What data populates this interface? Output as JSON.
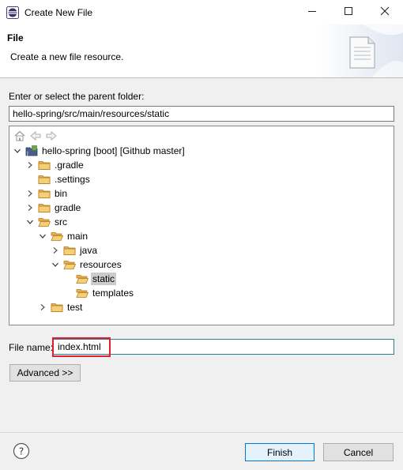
{
  "window": {
    "title": "Create New File",
    "icons": {
      "app": "eclipse-icon",
      "minimize": "minimize-icon",
      "maximize": "maximize-icon",
      "close": "close-icon"
    }
  },
  "header": {
    "title": "File",
    "description": "Create a new file resource.",
    "graphic": "new-file-wizard-icon"
  },
  "parent_folder": {
    "label": "Enter or select the parent folder:",
    "value": "hello-spring/src/main/resources/static"
  },
  "tree_toolbar": {
    "icons": [
      "home-icon",
      "back-arrow-icon",
      "forward-arrow-icon"
    ]
  },
  "tree": {
    "items": [
      {
        "label": "hello-spring [boot] [Github master]",
        "level": 0,
        "expanded": true,
        "type": "project"
      },
      {
        "label": ".gradle",
        "level": 1,
        "expanded": false,
        "type": "folder"
      },
      {
        "label": ".settings",
        "level": 1,
        "leaf": true,
        "type": "folder"
      },
      {
        "label": "bin",
        "level": 1,
        "expanded": false,
        "type": "folder"
      },
      {
        "label": "gradle",
        "level": 1,
        "expanded": false,
        "type": "folder"
      },
      {
        "label": "src",
        "level": 1,
        "expanded": true,
        "type": "folder"
      },
      {
        "label": "main",
        "level": 2,
        "expanded": true,
        "type": "folder"
      },
      {
        "label": "java",
        "level": 3,
        "expanded": false,
        "type": "folder"
      },
      {
        "label": "resources",
        "level": 3,
        "expanded": true,
        "type": "folder"
      },
      {
        "label": "static",
        "level": 4,
        "leaf": true,
        "type": "folder",
        "selected": true
      },
      {
        "label": "templates",
        "level": 4,
        "leaf": true,
        "type": "folder"
      },
      {
        "label": "test",
        "level": 2,
        "expanded": false,
        "type": "folder"
      }
    ]
  },
  "file_name": {
    "label": "File name:",
    "value": "index.html"
  },
  "buttons": {
    "advanced": "Advanced >>",
    "finish": "Finish",
    "cancel": "Cancel",
    "help_icon": "help-icon"
  },
  "colors": {
    "highlight": "#e0202a",
    "selection": "#cccccc",
    "folder": "#e8b04b",
    "dialog_bg": "#f0f0f0"
  }
}
